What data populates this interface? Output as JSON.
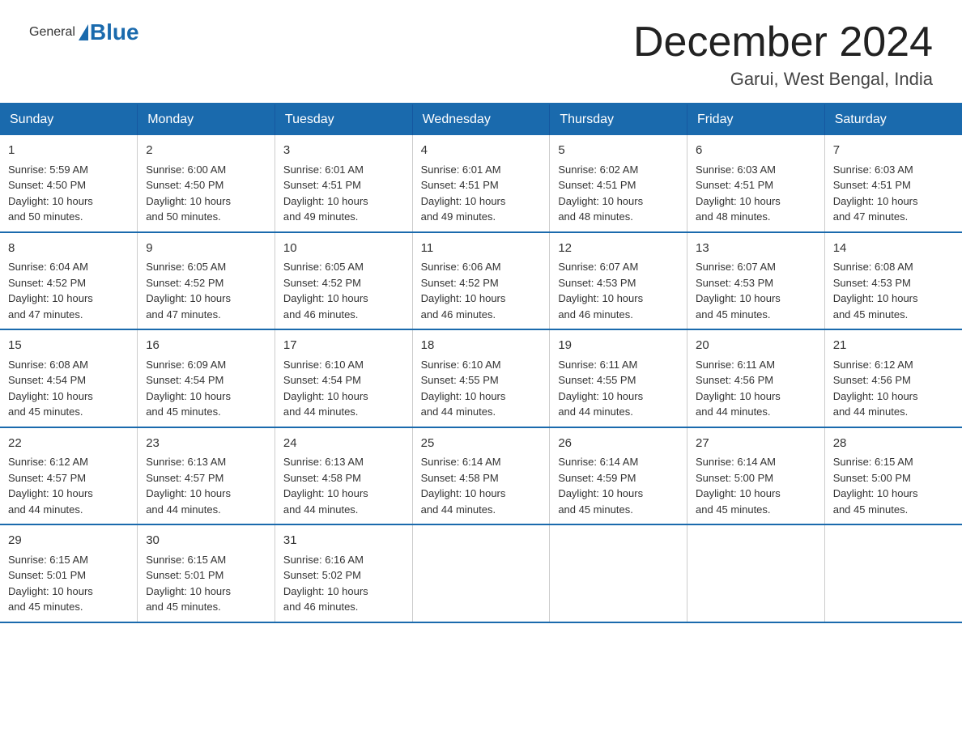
{
  "header": {
    "logo_general": "General",
    "logo_blue": "Blue",
    "title": "December 2024",
    "subtitle": "Garui, West Bengal, India"
  },
  "days_of_week": [
    "Sunday",
    "Monday",
    "Tuesday",
    "Wednesday",
    "Thursday",
    "Friday",
    "Saturday"
  ],
  "weeks": [
    [
      {
        "day": "1",
        "sunrise": "5:59 AM",
        "sunset": "4:50 PM",
        "daylight": "10 hours and 50 minutes."
      },
      {
        "day": "2",
        "sunrise": "6:00 AM",
        "sunset": "4:50 PM",
        "daylight": "10 hours and 50 minutes."
      },
      {
        "day": "3",
        "sunrise": "6:01 AM",
        "sunset": "4:51 PM",
        "daylight": "10 hours and 49 minutes."
      },
      {
        "day": "4",
        "sunrise": "6:01 AM",
        "sunset": "4:51 PM",
        "daylight": "10 hours and 49 minutes."
      },
      {
        "day": "5",
        "sunrise": "6:02 AM",
        "sunset": "4:51 PM",
        "daylight": "10 hours and 48 minutes."
      },
      {
        "day": "6",
        "sunrise": "6:03 AM",
        "sunset": "4:51 PM",
        "daylight": "10 hours and 48 minutes."
      },
      {
        "day": "7",
        "sunrise": "6:03 AM",
        "sunset": "4:51 PM",
        "daylight": "10 hours and 47 minutes."
      }
    ],
    [
      {
        "day": "8",
        "sunrise": "6:04 AM",
        "sunset": "4:52 PM",
        "daylight": "10 hours and 47 minutes."
      },
      {
        "day": "9",
        "sunrise": "6:05 AM",
        "sunset": "4:52 PM",
        "daylight": "10 hours and 47 minutes."
      },
      {
        "day": "10",
        "sunrise": "6:05 AM",
        "sunset": "4:52 PM",
        "daylight": "10 hours and 46 minutes."
      },
      {
        "day": "11",
        "sunrise": "6:06 AM",
        "sunset": "4:52 PM",
        "daylight": "10 hours and 46 minutes."
      },
      {
        "day": "12",
        "sunrise": "6:07 AM",
        "sunset": "4:53 PM",
        "daylight": "10 hours and 46 minutes."
      },
      {
        "day": "13",
        "sunrise": "6:07 AM",
        "sunset": "4:53 PM",
        "daylight": "10 hours and 45 minutes."
      },
      {
        "day": "14",
        "sunrise": "6:08 AM",
        "sunset": "4:53 PM",
        "daylight": "10 hours and 45 minutes."
      }
    ],
    [
      {
        "day": "15",
        "sunrise": "6:08 AM",
        "sunset": "4:54 PM",
        "daylight": "10 hours and 45 minutes."
      },
      {
        "day": "16",
        "sunrise": "6:09 AM",
        "sunset": "4:54 PM",
        "daylight": "10 hours and 45 minutes."
      },
      {
        "day": "17",
        "sunrise": "6:10 AM",
        "sunset": "4:54 PM",
        "daylight": "10 hours and 44 minutes."
      },
      {
        "day": "18",
        "sunrise": "6:10 AM",
        "sunset": "4:55 PM",
        "daylight": "10 hours and 44 minutes."
      },
      {
        "day": "19",
        "sunrise": "6:11 AM",
        "sunset": "4:55 PM",
        "daylight": "10 hours and 44 minutes."
      },
      {
        "day": "20",
        "sunrise": "6:11 AM",
        "sunset": "4:56 PM",
        "daylight": "10 hours and 44 minutes."
      },
      {
        "day": "21",
        "sunrise": "6:12 AM",
        "sunset": "4:56 PM",
        "daylight": "10 hours and 44 minutes."
      }
    ],
    [
      {
        "day": "22",
        "sunrise": "6:12 AM",
        "sunset": "4:57 PM",
        "daylight": "10 hours and 44 minutes."
      },
      {
        "day": "23",
        "sunrise": "6:13 AM",
        "sunset": "4:57 PM",
        "daylight": "10 hours and 44 minutes."
      },
      {
        "day": "24",
        "sunrise": "6:13 AM",
        "sunset": "4:58 PM",
        "daylight": "10 hours and 44 minutes."
      },
      {
        "day": "25",
        "sunrise": "6:14 AM",
        "sunset": "4:58 PM",
        "daylight": "10 hours and 44 minutes."
      },
      {
        "day": "26",
        "sunrise": "6:14 AM",
        "sunset": "4:59 PM",
        "daylight": "10 hours and 45 minutes."
      },
      {
        "day": "27",
        "sunrise": "6:14 AM",
        "sunset": "5:00 PM",
        "daylight": "10 hours and 45 minutes."
      },
      {
        "day": "28",
        "sunrise": "6:15 AM",
        "sunset": "5:00 PM",
        "daylight": "10 hours and 45 minutes."
      }
    ],
    [
      {
        "day": "29",
        "sunrise": "6:15 AM",
        "sunset": "5:01 PM",
        "daylight": "10 hours and 45 minutes."
      },
      {
        "day": "30",
        "sunrise": "6:15 AM",
        "sunset": "5:01 PM",
        "daylight": "10 hours and 45 minutes."
      },
      {
        "day": "31",
        "sunrise": "6:16 AM",
        "sunset": "5:02 PM",
        "daylight": "10 hours and 46 minutes."
      },
      null,
      null,
      null,
      null
    ]
  ],
  "labels": {
    "sunrise": "Sunrise:",
    "sunset": "Sunset:",
    "daylight": "Daylight:"
  }
}
